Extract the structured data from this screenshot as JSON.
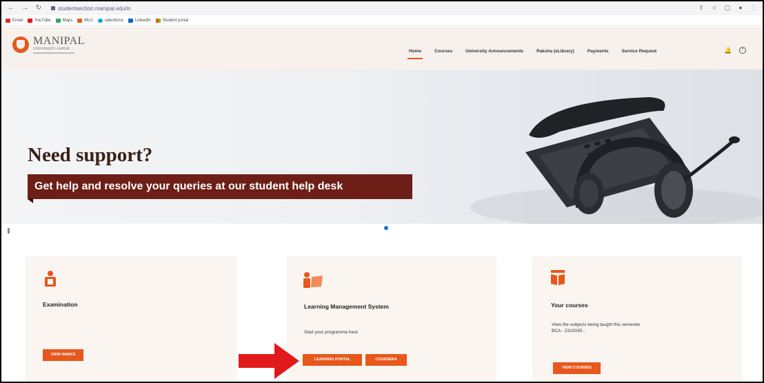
{
  "browser": {
    "url": "studentsection.manipal.edu/in",
    "bookmarks": [
      "Email",
      "YouTube",
      "Maps",
      "MUJ",
      "salesforce",
      "LinkedIn",
      "Student portal"
    ]
  },
  "header": {
    "logo_line1": "MANIPAL",
    "logo_line2": "UNIVERSITY JAIPUR",
    "nav": [
      "Home",
      "Courses",
      "University Announcements",
      "Raksha (eLibrary)",
      "Payments",
      "Service Request"
    ],
    "active_nav": "Home"
  },
  "hero": {
    "title": "Need support?",
    "subtitle": "Get help and resolve your queries at our student help desk",
    "slide_current": 1
  },
  "cards": [
    {
      "title": "Examination",
      "description": "",
      "buttons": [
        "VIEW MARKS"
      ]
    },
    {
      "title": "Learning Management System",
      "description": "Start your programme here",
      "buttons": [
        "LEARNING PORTAL",
        "COURSERA"
      ]
    },
    {
      "title": "Your courses",
      "description": "View the subjects being taught this semester",
      "description2": "BCA - 2310035...",
      "buttons": [
        "VIEW COURSES"
      ]
    }
  ],
  "colors": {
    "brand_orange": "#e8571c",
    "hero_banner": "#6d1f17",
    "card_bg": "#faf5f1",
    "annotation_arrow": "#e0191b"
  }
}
